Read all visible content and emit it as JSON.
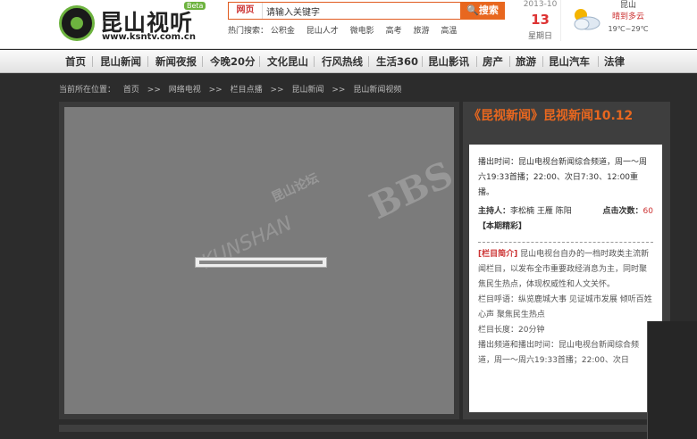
{
  "header": {
    "logo_text": "昆山视听",
    "logo_url": "www.ksntv.com.cn",
    "beta": "Beta",
    "search": {
      "tab": "网页",
      "placeholder": "请输入关键字",
      "value": "请输入关键字",
      "button": "搜索"
    },
    "hot": {
      "label": "热门搜索：",
      "items": [
        "公积金",
        "昆山人才",
        "微电影",
        "高考",
        "旅游",
        "高温"
      ]
    },
    "date": {
      "year_month": "2013-10",
      "day": "13",
      "weekday": "星期日"
    },
    "weather": {
      "city": "昆山",
      "desc": "晴到多云",
      "temp": "19℃~29℃"
    }
  },
  "nav": {
    "items": [
      "首页",
      "昆山新闻",
      "新闻夜报",
      "今晚20分",
      "文化昆山",
      "行风热线",
      "生活360",
      "昆山影讯",
      "房产",
      "旅游",
      "昆山汽车",
      "法律"
    ]
  },
  "breadcrumb": {
    "label": "当前所在位置：",
    "items": [
      "首页",
      ">>",
      "网络电视",
      ">>",
      "栏目点播",
      ">>",
      "昆山新闻",
      ">>",
      "昆山新闻视频"
    ]
  },
  "player": {
    "watermark_cn": "昆山论坛",
    "watermark_bbs": "BBS",
    "watermark_en": "KUNSHAN"
  },
  "side": {
    "title": "《昆视新闻》昆视新闻10.12",
    "airtime_label": "播出时间：",
    "airtime": "昆山电视台新闻综合频道，周一～周六19:33首播；22:00、次日7:30、12:00重播。",
    "host_label": "主持人：",
    "hosts": "李松楠 王雁 陈阳",
    "clicks_label": "点击次数：",
    "clicks": "60",
    "highlight": "【本期精彩】",
    "intro_tag": "[栏目简介]",
    "intro": "昆山电视台自办的一档时政类主流新闻栏目，以发布全市重要政经消息为主，同时聚焦民生热点，体现权威性和人文关怀。",
    "slogan": "栏目呼语：纵览鹿城大事 见证城市发展 倾听百姓心声 聚焦民生热点",
    "length": "栏目长度：20分钟",
    "channel": "播出频道和播出时间：昆山电视台新闻综合频道，周一～周六19:33首播；22:00、次日"
  },
  "colors": {
    "accent": "#e8671f",
    "red": "#cc3333",
    "bg": "#2c2c2c"
  }
}
